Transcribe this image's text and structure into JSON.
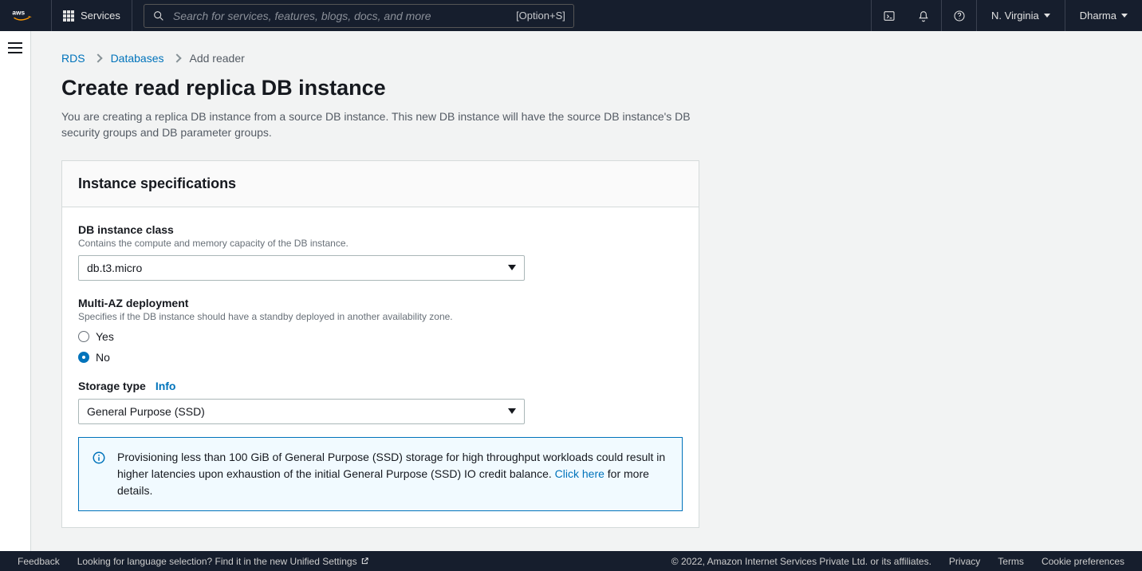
{
  "nav": {
    "services": "Services",
    "search_placeholder": "Search for services, features, blogs, docs, and more",
    "search_shortcut": "[Option+S]",
    "region": "N. Virginia",
    "user": "Dharma"
  },
  "breadcrumb": {
    "rds": "RDS",
    "databases": "Databases",
    "current": "Add reader"
  },
  "page": {
    "title": "Create read replica DB instance",
    "description": "You are creating a replica DB instance from a source DB instance. This new DB instance will have the source DB instance's DB security groups and DB parameter groups."
  },
  "panel": {
    "title": "Instance specifications",
    "db_class": {
      "label": "DB instance class",
      "hint": "Contains the compute and memory capacity of the DB instance.",
      "value": "db.t3.micro"
    },
    "multi_az": {
      "label": "Multi-AZ deployment",
      "hint": "Specifies if the DB instance should have a standby deployed in another availability zone.",
      "yes": "Yes",
      "no": "No"
    },
    "storage": {
      "label": "Storage type",
      "info": "Info",
      "value": "General Purpose (SSD)"
    },
    "alert": {
      "text_a": "Provisioning less than 100 GiB of General Purpose (SSD) storage for high throughput workloads could result in higher latencies upon exhaustion of the initial General Purpose (SSD) IO credit balance. ",
      "link": "Click here",
      "text_b": " for more details."
    }
  },
  "footer": {
    "feedback": "Feedback",
    "lang_prompt": "Looking for language selection? Find it in the new ",
    "unified": "Unified Settings",
    "copyright": "© 2022, Amazon Internet Services Private Ltd. or its affiliates.",
    "privacy": "Privacy",
    "terms": "Terms",
    "cookies": "Cookie preferences"
  }
}
